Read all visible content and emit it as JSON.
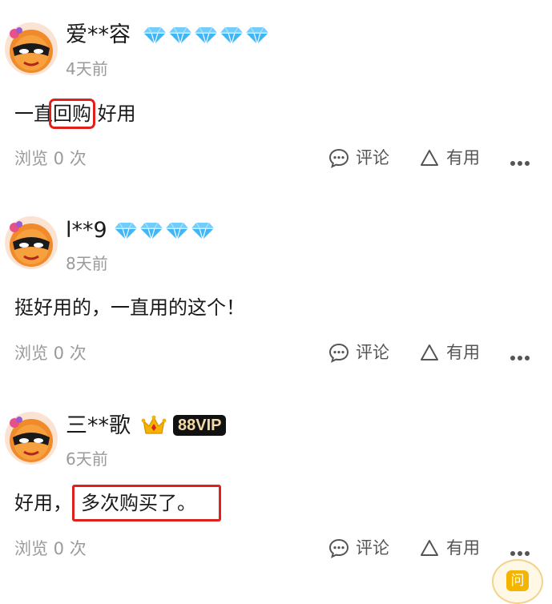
{
  "actions": {
    "comment_label": "评论",
    "helpful_label": "有用"
  },
  "colors": {
    "highlight_box": "#e0201c",
    "meta_gray": "#9a9a9a",
    "diamond": "#3fb6f5",
    "vip_gold": "#f3d9a6"
  },
  "reviews": [
    {
      "username": "爱**容",
      "badge": "diamond",
      "badge_count": 5,
      "date": "4天前",
      "content_parts": [
        "一直",
        "回购",
        " 好用"
      ],
      "views": "浏览 0 次"
    },
    {
      "username": "l**9",
      "badge": "diamond",
      "badge_count": 4,
      "date": "8天前",
      "content_parts": [
        "挺好用的，一直用的这个！"
      ],
      "views": "浏览 0 次"
    },
    {
      "username": "三**歌",
      "badge": "crown",
      "vip_label": "88VIP",
      "date": "6天前",
      "content_parts": [
        "好用，",
        "多次购买了。"
      ],
      "views": "浏览 0 次"
    }
  ],
  "floating": {
    "ask_label": "问",
    "ask_icon": "question-bubble-icon"
  }
}
